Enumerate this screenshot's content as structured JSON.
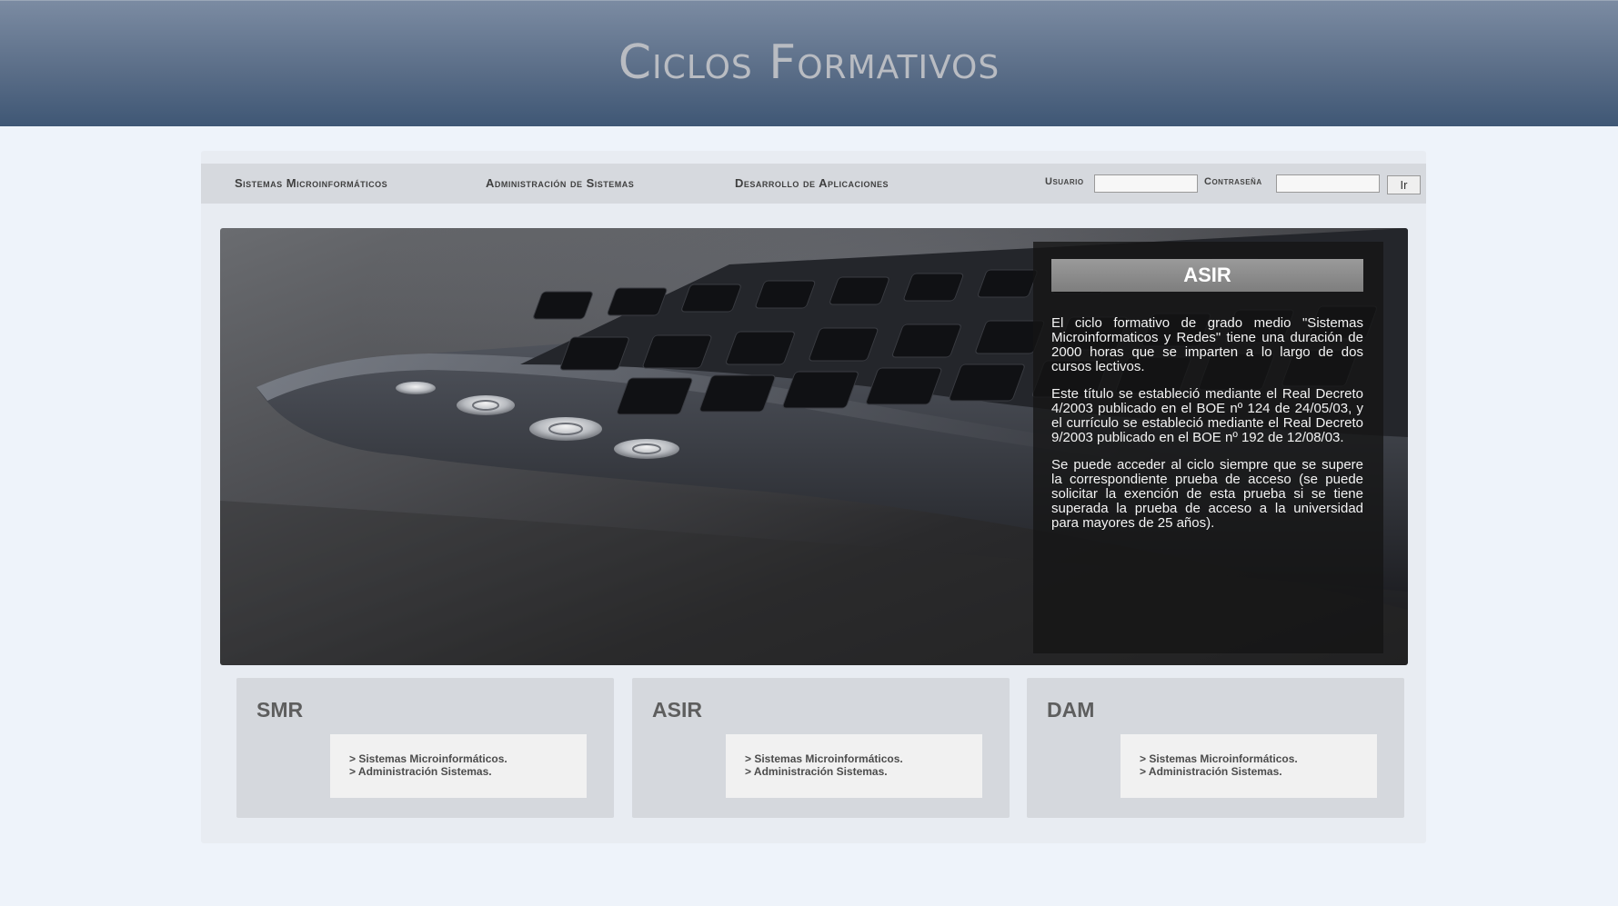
{
  "header": {
    "title": "Ciclos Formativos"
  },
  "nav": {
    "items": [
      {
        "label": "Sistemas Microinformáticos"
      },
      {
        "label": "Administración de Sistemas"
      },
      {
        "label": "Desarrollo de Aplicaciones"
      }
    ]
  },
  "login": {
    "user_label": "Usuario",
    "user_value": "",
    "password_label": "Contraseña",
    "password_value": "",
    "submit_label": "Ir"
  },
  "hero": {
    "panel_title": "ASIR",
    "paragraphs": [
      "El ciclo formativo de grado medio \"Sistemas Microinformaticos y Redes\" tiene una duración de 2000 horas que se imparten a lo largo de dos cursos lectivos.",
      "Este título se estableció mediante el Real Decreto 4/2003 publicado en el BOE nº 124 de 24/05/03, y el currículo se estableció mediante el Real Decreto 9/2003 publicado en el BOE nº 192 de 12/08/03.",
      "Se puede acceder al ciclo siempre que se supere la correspondiente prueba de acceso (se puede solicitar la exención de esta prueba si se tiene superada la prueba de acceso a la universidad para mayores de 25 años)."
    ]
  },
  "cards": [
    {
      "title": "SMR",
      "links": [
        "> Sistemas Microinformáticos.",
        "> Administración Sistemas."
      ]
    },
    {
      "title": "ASIR",
      "links": [
        "> Sistemas Microinformáticos.",
        "> Administración Sistemas."
      ]
    },
    {
      "title": "DAM",
      "links": [
        "> Sistemas Microinformáticos.",
        "> Administración Sistemas."
      ]
    }
  ]
}
